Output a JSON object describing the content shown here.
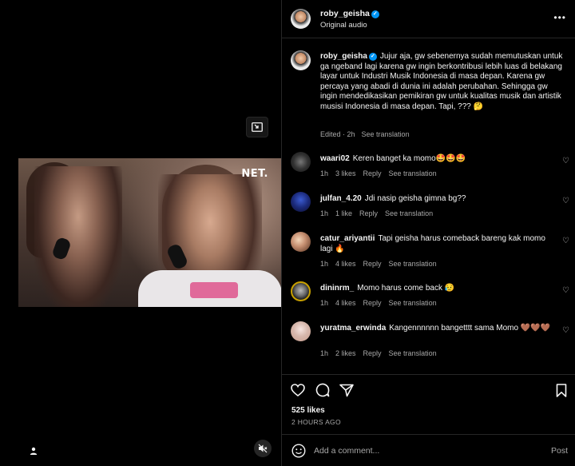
{
  "video": {
    "watermark": "NET."
  },
  "header": {
    "username": "roby_geisha",
    "audio": "Original audio"
  },
  "caption": {
    "username": "roby_geisha",
    "text": "Jujur aja, gw sebenernya sudah memutuskan untuk ga ngeband lagi karena gw ingin berkontribusi lebih luas di belakang layar untuk Industri Musik Indonesia di masa depan. Karena gw percaya yang abadi di dunia ini adalah perubahan. Sehingga gw ingin mendedikasikan pemikiran gw untuk kualitas musik dan artistik musisi Indonesia di masa depan. Tapi, ??? 🤔",
    "edited": "Edited · 2h",
    "see_translation": "See translation"
  },
  "comments": [
    {
      "username": "waari02",
      "text": "Keren banget ka momo🤩🤩🤩",
      "time": "1h",
      "likes": "3 likes",
      "reply": "Reply",
      "see_translation": "See translation"
    },
    {
      "username": "julfan_4.20",
      "text": "Jdi nasip geisha gimna bg??",
      "time": "1h",
      "likes": "1 like",
      "reply": "Reply",
      "see_translation": "See translation"
    },
    {
      "username": "catur_ariyantii",
      "text": "Tapi geisha harus comeback bareng kak momo lagi 🔥",
      "time": "1h",
      "likes": "4 likes",
      "reply": "Reply",
      "see_translation": "See translation"
    },
    {
      "username": "dininrm_",
      "text": "Momo harus come back 😥",
      "time": "1h",
      "likes": "4 likes",
      "reply": "Reply",
      "see_translation": "See translation"
    },
    {
      "username": "yuratma_erwinda",
      "text": "Kangennnnnn bangetttt sama Momo 🤎🤎🤎",
      "time": "1h",
      "likes": "2 likes",
      "reply": "Reply",
      "see_translation": "See translation"
    }
  ],
  "stats": {
    "likes": "525 likes",
    "time_ago": "2 HOURS AGO"
  },
  "comment_box": {
    "placeholder": "Add a comment...",
    "post_label": "Post"
  },
  "icons": {
    "like": "heart-icon",
    "comment": "speech-bubble-icon",
    "share": "paper-plane-icon",
    "save": "bookmark-icon",
    "emoji": "smiley-icon",
    "more": "more-icon",
    "pip": "picture-in-picture-icon",
    "mute": "speaker-muted-icon",
    "tag": "user-tag-icon",
    "verified": "verified-badge-icon"
  },
  "colors": {
    "background": "#000000",
    "text": "#f5f5f5",
    "secondary": "#a8a8a8",
    "verified": "#0095f6",
    "divider": "#262626"
  }
}
